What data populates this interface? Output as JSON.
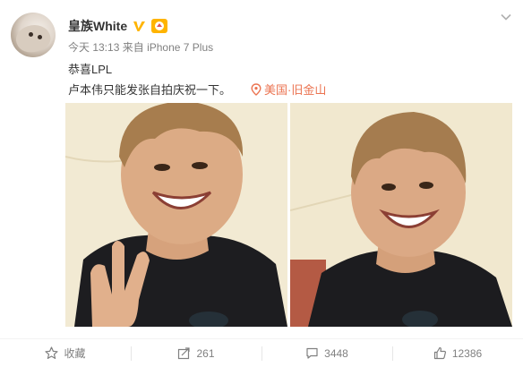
{
  "user": {
    "name": "皇族White",
    "avatar_icon": "cat-avatar",
    "verified_icon": "verified-v-icon",
    "level_icon": "member-badge-icon",
    "accent": "#ffb400"
  },
  "meta": {
    "time": "今天 13:13",
    "source_prefix": "来自",
    "device": "iPhone 7 Plus"
  },
  "post": {
    "line1": "恭喜LPL",
    "line2": "卢本伟只能发张自拍庆祝一下。",
    "location": "美国·旧金山",
    "location_color": "#eb7350"
  },
  "photos": [
    {
      "name": "selfie-photo-peace-sign"
    },
    {
      "name": "selfie-photo-smile"
    }
  ],
  "actions": {
    "favorite_label": "收藏",
    "share_count": "261",
    "comment_count": "3448",
    "like_count": "12386"
  }
}
